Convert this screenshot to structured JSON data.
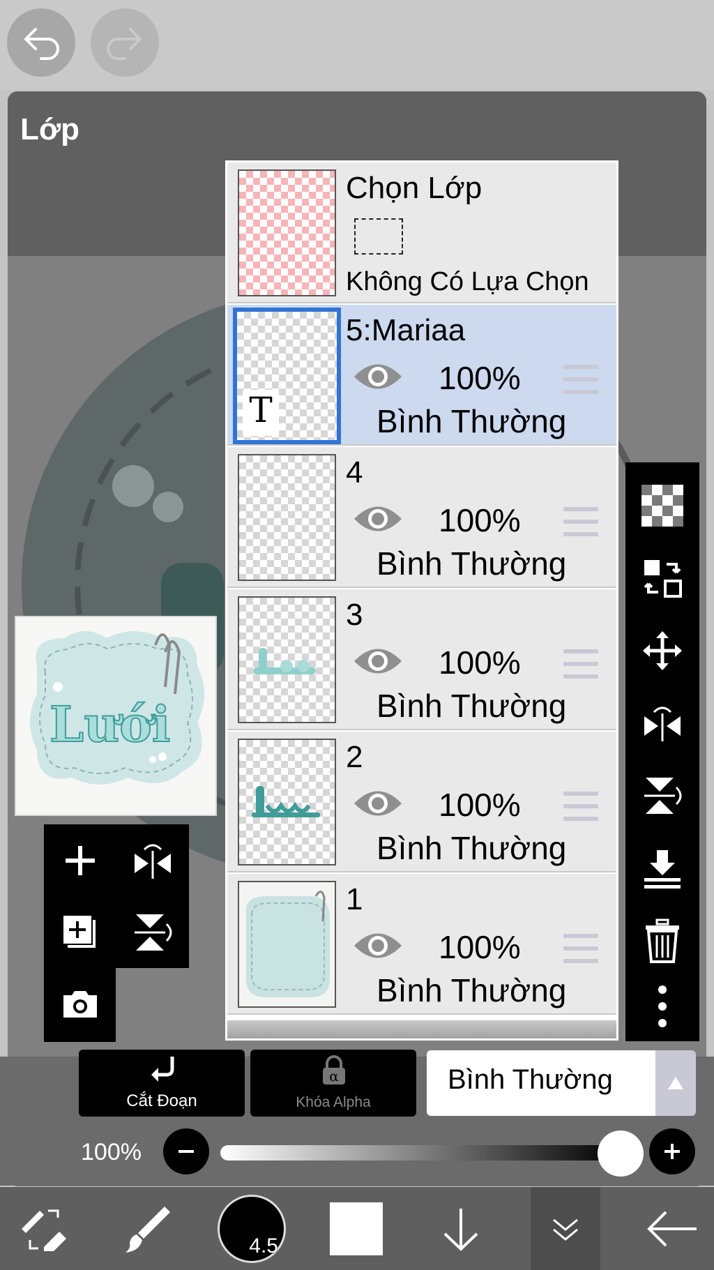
{
  "panel": {
    "title": "Lớp"
  },
  "selection_layer": {
    "label": "Chọn Lớp",
    "status": "Không Có Lựa Chọn"
  },
  "layers": [
    {
      "name": "5:Mariaa",
      "opacity": "100%",
      "mode": "Bình Thường",
      "selected": true,
      "thumb_text": "T"
    },
    {
      "name": "4",
      "opacity": "100%",
      "mode": "Bình Thường",
      "selected": false
    },
    {
      "name": "3",
      "opacity": "100%",
      "mode": "Bình Thường",
      "selected": false
    },
    {
      "name": "2",
      "opacity": "100%",
      "mode": "Bình Thường",
      "selected": false
    },
    {
      "name": "1",
      "opacity": "100%",
      "mode": "Bình Thường",
      "selected": false
    }
  ],
  "controls": {
    "clip_label": "Cắt Đoạn",
    "alpha_lock_label": "Khóa Alpha",
    "blend_mode": "Bình Thường",
    "opacity_label": "100%",
    "opacity_fraction": 1.0
  },
  "toolbar": {
    "brush_size": "4.5"
  },
  "colors": {
    "accent": "#2f74d6",
    "selected_row": "#ccd9ee",
    "swatch": "#ffffff"
  }
}
